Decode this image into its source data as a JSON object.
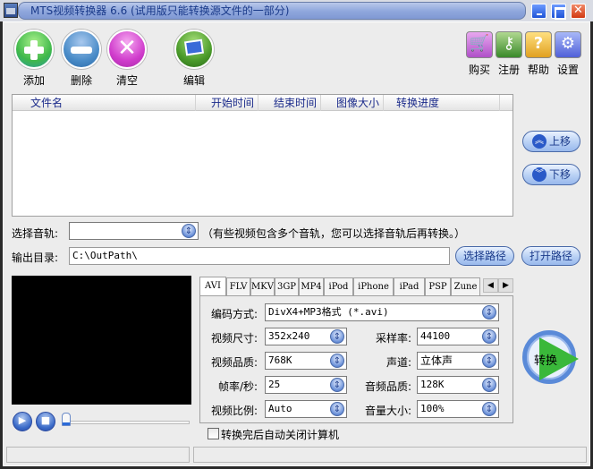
{
  "window": {
    "title": "MTS视频转换器 6.6 (试用版只能转换源文件的一部分)",
    "controls": [
      "minimize",
      "maximize",
      "close"
    ]
  },
  "toolbar": {
    "left": [
      {
        "label": "添加",
        "icon": "plus-icon"
      },
      {
        "label": "删除",
        "icon": "minus-icon"
      },
      {
        "label": "清空",
        "icon": "x-icon"
      },
      {
        "label": "编辑",
        "icon": "edit-icon"
      }
    ],
    "right": [
      {
        "label": "购买",
        "icon": "cart-icon"
      },
      {
        "label": "注册",
        "icon": "key-icon"
      },
      {
        "label": "帮助",
        "icon": "help-icon"
      },
      {
        "label": "设置",
        "icon": "tools-icon"
      }
    ]
  },
  "file_list": {
    "columns": [
      "文件名",
      "开始时间",
      "结束时间",
      "图像大小",
      "转换进度"
    ],
    "rows": []
  },
  "side_buttons": {
    "move_up": "上移",
    "move_down": "下移"
  },
  "audio_track": {
    "label": "选择音轨:",
    "value": "",
    "hint": "（有些视频包含多个音轨，您可以选择音轨后再转换。）"
  },
  "output": {
    "label": "输出目录:",
    "value": "C:\\OutPath\\",
    "choose_label": "选择路径",
    "open_label": "打开路径"
  },
  "format_tabs": {
    "tabs": [
      "AVI",
      "FLV",
      "MKV",
      "3GP",
      "MP4",
      "iPod",
      "iPhone",
      "iPad",
      "PSP",
      "Zune"
    ],
    "active": "AVI"
  },
  "settings": {
    "codec": {
      "label": "编码方式:",
      "value": "DivX4+MP3格式 (*.avi)"
    },
    "video_size": {
      "label": "视频尺寸:",
      "value": "352x240"
    },
    "video_quality": {
      "label": "视频品质:",
      "value": "768K"
    },
    "frame_rate": {
      "label": "帧率/秒:",
      "value": "25"
    },
    "aspect_ratio": {
      "label": "视频比例:",
      "value": "Auto"
    },
    "sample_rate": {
      "label": "采样率:",
      "value": "44100"
    },
    "channels": {
      "label": "声道:",
      "value": "立体声"
    },
    "audio_quality": {
      "label": "音频品质:",
      "value": "128K"
    },
    "volume": {
      "label": "音量大小:",
      "value": "100%"
    }
  },
  "convert_button": "转换",
  "auto_shutdown": {
    "label": "转换完后自动关闭计算机",
    "checked": false
  },
  "player": {
    "position": 0
  },
  "status_bar": {
    "left": "",
    "right": ""
  }
}
